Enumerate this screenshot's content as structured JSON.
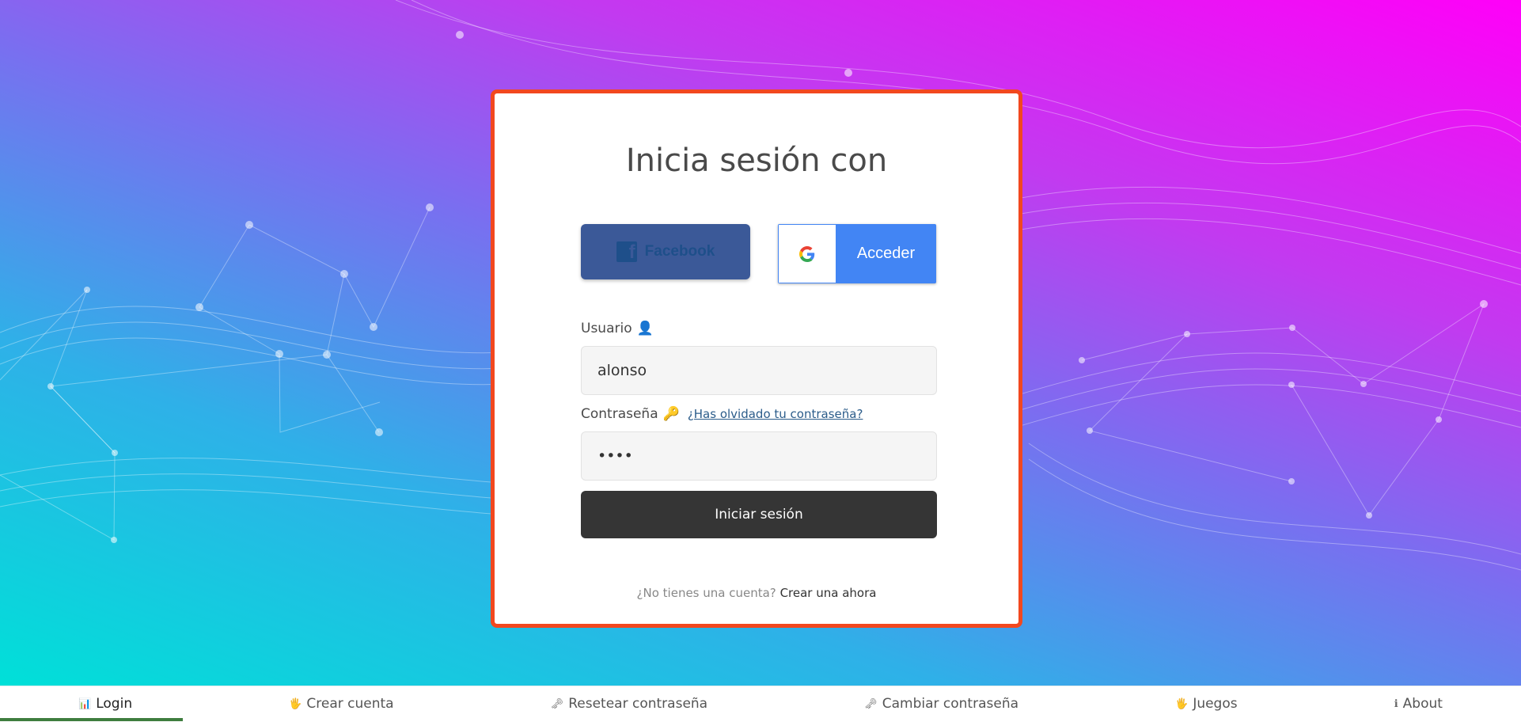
{
  "login": {
    "title": "Inicia sesión con",
    "facebook_label": "Facebook",
    "google_label": "Acceder",
    "username_label": "Usuario",
    "username_emoji": "👤",
    "username_value": "alonso",
    "password_label": "Contraseña",
    "password_emoji": "🔑",
    "password_value": "1234",
    "forgot_link": "¿Has olvidado tu contraseña?",
    "submit_label": "Iniciar sesión",
    "signup_prompt": "¿No tienes una cuenta?",
    "signup_link": "Crear una ahora"
  },
  "nav": {
    "items": [
      {
        "label": "Login",
        "icon": "📊"
      },
      {
        "label": "Crear cuenta",
        "icon": "🖐"
      },
      {
        "label": "Resetear contraseña",
        "icon": "🗝"
      },
      {
        "label": "Cambiar contraseña",
        "icon": "🗝"
      },
      {
        "label": "Juegos",
        "icon": "🖐"
      },
      {
        "label": "About",
        "icon": "ℹ"
      }
    ]
  },
  "colors": {
    "card_border": "#f2481f",
    "facebook": "#3b5998",
    "google": "#4285f4",
    "submit": "#353535",
    "active_tab": "#3e7d3e"
  }
}
